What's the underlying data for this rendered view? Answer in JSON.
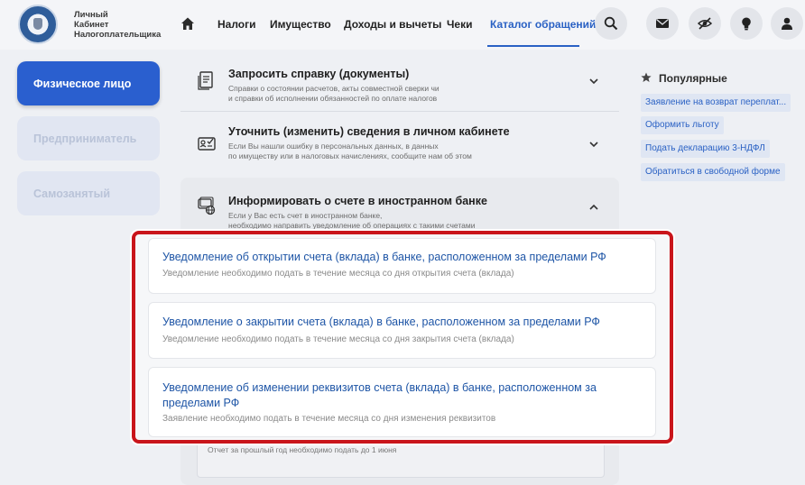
{
  "header": {
    "logo_lines": [
      "Личный",
      "Кабинет",
      "Налогоплательщика"
    ],
    "nav": [
      "Налоги",
      "Имущество",
      "Доходы и вычеты",
      "Чеки",
      "Каталог обращений"
    ],
    "accent": "#2a61c4"
  },
  "sidebar": {
    "items": [
      {
        "label": "Физическое лицо"
      },
      {
        "label": "Предприниматель"
      },
      {
        "label": "Самозанятый"
      }
    ]
  },
  "catalog": {
    "items": [
      {
        "title": "Запросить справку (документы)",
        "desc": [
          "Справки о состоянии расчетов, акты совместной сверки чи",
          "и справки об исполнении обязанностей по оплате налогов"
        ]
      },
      {
        "title": "Уточнить (изменить) сведения в личном кабинете",
        "desc": [
          "Если Вы нашли ошибку в персональных данных, в данных",
          "по имуществу или в налоговых начислениях, сообщите нам  об этом"
        ]
      },
      {
        "title": "Информировать о счете в иностранном банке",
        "desc": [
          "Если у Вас есть счет в иностранном банке,",
          "необходимо направить уведомление об операциях с такими счетами"
        ]
      }
    ]
  },
  "popular": {
    "title": "Популярные",
    "links": [
      "Заявление на возврат переплат...",
      "Оформить льготу",
      "Подать декларацию 3-НДФЛ",
      "Обратиться в свободной форме"
    ]
  },
  "notifications": [
    {
      "title": "Уведомление об открытии счета (вклада) в банке, расположенном за пределами РФ",
      "subtitle": "Уведомление необходимо подать в течение месяца со дня открытия счета (вклада)"
    },
    {
      "title": "Уведомление о закрытии счета (вклада) в банке, расположенном за пределами РФ",
      "subtitle": "Уведомление необходимо подать в течение месяца со дня закрытия счета (вклада)"
    },
    {
      "title_lines": [
        "Уведомление об изменении реквизитов счета (вклада) в банке, расположенном за",
        "пределами РФ"
      ],
      "subtitle": "Заявление необходимо подать в течение месяца со дня изменения реквизитов"
    }
  ],
  "footer_note": "Отчет за прошлый год необходимо подать до 1 июня",
  "colors": {
    "highlight": "#c9151b",
    "primary": "#2a5fcf",
    "link": "#1e55a6"
  }
}
